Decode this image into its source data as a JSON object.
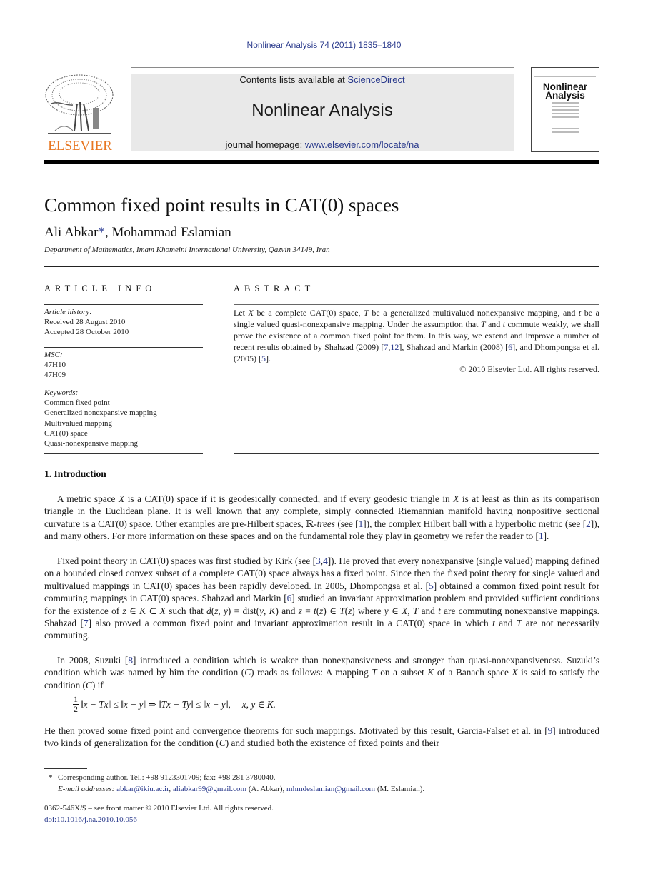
{
  "running_head": "Nonlinear Analysis 74 (2011) 1835–1840",
  "masthead": {
    "publisher_logo_text": "ELSEVIER",
    "contents_prefix": "Contents lists available at ",
    "contents_link": "ScienceDirect",
    "journal_name": "Nonlinear Analysis",
    "homepage_prefix": "journal homepage: ",
    "homepage_link": "www.elsevier.com/locate/na",
    "cover_title_line1": "Nonlinear",
    "cover_title_line2": "Analysis",
    "colors": {
      "publisher_orange": "#e87722",
      "link_blue": "#2a3a8c",
      "band_gray": "#e9e9e9"
    }
  },
  "article": {
    "title": "Common fixed point results in CAT(0) spaces",
    "authors": [
      {
        "name": "Ali Abkar",
        "mark": "*"
      },
      {
        "name": "Mohammad Eslamian",
        "mark": ""
      }
    ],
    "author_separator": ", ",
    "affiliation": "Department of Mathematics, Imam Khomeini International University, Qazvin 34149, Iran"
  },
  "article_info": {
    "heading": "ARTICLE INFO",
    "history_label": "Article history:",
    "received": "Received 28 August 2010",
    "accepted": "Accepted 28 October 2010",
    "msc_label": "MSC:",
    "msc": [
      "47H10",
      "47H09"
    ],
    "keywords_label": "Keywords:",
    "keywords": [
      "Common fixed point",
      "Generalized nonexpansive mapping",
      "Multivalued mapping",
      "CAT(0) space",
      "Quasi-nonexpansive mapping"
    ]
  },
  "abstract": {
    "heading": "ABSTRACT",
    "segments": [
      {
        "t": "Let "
      },
      {
        "t": "X",
        "i": true
      },
      {
        "t": " be a complete CAT(0) space, "
      },
      {
        "t": "T",
        "i": true
      },
      {
        "t": " be a generalized multivalued nonexpansive mapping, and "
      },
      {
        "t": "t",
        "i": true
      },
      {
        "t": " be a single valued quasi-nonexpansive mapping. Under the assumption that "
      },
      {
        "t": "T",
        "i": true
      },
      {
        "t": " and "
      },
      {
        "t": "t",
        "i": true
      },
      {
        "t": " commute weakly, we shall prove the existence of a common fixed point for them. In this way, we extend and improve a number of recent results obtained by Shahzad (2009) ["
      },
      {
        "t": "7",
        "link": true
      },
      {
        "t": ","
      },
      {
        "t": "12",
        "link": true
      },
      {
        "t": "], Shahzad and Markin (2008) ["
      },
      {
        "t": "6",
        "link": true
      },
      {
        "t": "], and Dhompongsa et al. (2005) ["
      },
      {
        "t": "5",
        "link": true
      },
      {
        "t": "]."
      }
    ],
    "copyright": "© 2010 Elsevier Ltd. All rights reserved."
  },
  "section": {
    "heading": "1. Introduction",
    "paragraphs": [
      [
        {
          "t": "A metric space "
        },
        {
          "t": "X",
          "i": true
        },
        {
          "t": " is a CAT(0) space if it is geodesically connected, and if every geodesic triangle in "
        },
        {
          "t": "X",
          "i": true
        },
        {
          "t": " is at least as thin as its comparison triangle in the Euclidean plane. It is well known that any complete, simply connected Riemannian manifold having nonpositive sectional curvature is a CAT(0) space. Other examples are pre-Hilbert spaces, ℝ-"
        },
        {
          "t": "trees",
          "i": true
        },
        {
          "t": " (see ["
        },
        {
          "t": "1",
          "link": true
        },
        {
          "t": "]), the complex Hilbert ball with a hyperbolic metric (see ["
        },
        {
          "t": "2",
          "link": true
        },
        {
          "t": "]), and many others. For more information on these spaces and on the fundamental role they play in geometry we refer the reader to ["
        },
        {
          "t": "1",
          "link": true
        },
        {
          "t": "]."
        }
      ],
      [
        {
          "t": "Fixed point theory in CAT(0) spaces was first studied by Kirk (see ["
        },
        {
          "t": "3",
          "link": true
        },
        {
          "t": ","
        },
        {
          "t": "4",
          "link": true
        },
        {
          "t": "]). He proved that every nonexpansive (single valued) mapping defined on a bounded closed convex subset of a complete CAT(0) space always has a fixed point. Since then the fixed point theory for single valued and multivalued mappings in CAT(0) spaces has been rapidly developed. In 2005, Dhompongsa et al. ["
        },
        {
          "t": "5",
          "link": true
        },
        {
          "t": "] obtained a common fixed point result for commuting mappings in CAT(0) spaces. Shahzad and Markin ["
        },
        {
          "t": "6",
          "link": true
        },
        {
          "t": "] studied an invariant approximation problem and provided sufficient conditions for the existence of "
        },
        {
          "t": "z",
          "i": true
        },
        {
          "t": " ∈ "
        },
        {
          "t": "K",
          "i": true
        },
        {
          "t": " ⊂ "
        },
        {
          "t": "X",
          "i": true
        },
        {
          "t": " such that "
        },
        {
          "t": "d",
          "i": true
        },
        {
          "t": "("
        },
        {
          "t": "z",
          "i": true
        },
        {
          "t": ", "
        },
        {
          "t": "y",
          "i": true
        },
        {
          "t": ") = dist("
        },
        {
          "t": "y",
          "i": true
        },
        {
          "t": ", "
        },
        {
          "t": "K",
          "i": true
        },
        {
          "t": ") and "
        },
        {
          "t": "z",
          "i": true
        },
        {
          "t": " = "
        },
        {
          "t": "t",
          "i": true
        },
        {
          "t": "("
        },
        {
          "t": "z",
          "i": true
        },
        {
          "t": ") ∈ "
        },
        {
          "t": "T",
          "i": true
        },
        {
          "t": "("
        },
        {
          "t": "z",
          "i": true
        },
        {
          "t": ") where "
        },
        {
          "t": "y",
          "i": true
        },
        {
          "t": " ∈ "
        },
        {
          "t": "X",
          "i": true
        },
        {
          "t": ", "
        },
        {
          "t": "T",
          "i": true
        },
        {
          "t": " and "
        },
        {
          "t": "t",
          "i": true
        },
        {
          "t": " are commuting nonexpansive mappings. Shahzad ["
        },
        {
          "t": "7",
          "link": true
        },
        {
          "t": "] also proved a common fixed point and invariant approximation result in a CAT(0) space in which "
        },
        {
          "t": "t",
          "i": true
        },
        {
          "t": " and "
        },
        {
          "t": "T",
          "i": true
        },
        {
          "t": " are not necessarily commuting."
        }
      ],
      [
        {
          "t": "In 2008, Suzuki ["
        },
        {
          "t": "8",
          "link": true
        },
        {
          "t": "] introduced a condition which is weaker than nonexpansiveness and stronger than quasi-nonexpansiveness. Suzuki’s condition which was named by him the condition ("
        },
        {
          "t": "C",
          "i": true
        },
        {
          "t": ") reads as follows: A mapping "
        },
        {
          "t": "T",
          "i": true
        },
        {
          "t": " on a subset "
        },
        {
          "t": "K",
          "i": true
        },
        {
          "t": " of a Banach space "
        },
        {
          "t": "X",
          "i": true
        },
        {
          "t": " is said to satisfy the condition ("
        },
        {
          "t": "C",
          "i": true
        },
        {
          "t": ") if"
        }
      ]
    ],
    "equation": {
      "frac_num": "1",
      "frac_den": "2",
      "body": "‖x − Tx‖ ≤ ‖x − y‖ ⇒ ‖Tx − Ty‖ ≤ ‖x − y‖,",
      "tail": "x, y ∈ K."
    },
    "paragraph_after": [
      {
        "t": "He then proved some fixed point and convergence theorems for such mappings. Motivated by this result, Garcia-Falset et al. in ["
      },
      {
        "t": "9",
        "link": true
      },
      {
        "t": "] introduced two kinds of generalization for the condition ("
      },
      {
        "t": "C",
        "i": true
      },
      {
        "t": ") and studied both the existence of fixed points and their"
      }
    ]
  },
  "footnote": {
    "star": "*",
    "corresponding": "Corresponding author. Tel.: +98 9123301709; fax: +98 281 3780040.",
    "email_label": "E-mail addresses:",
    "emails": [
      {
        "addr": "abkar@ikiu.ac.ir",
        "sep": ", "
      },
      {
        "addr": "aliabkar99@gmail.com",
        "sep": " (A. Abkar), "
      },
      {
        "addr": "mhmdeslamian@gmail.com",
        "sep": " (M. Eslamian)."
      }
    ]
  },
  "front_matter": {
    "issn_line": "0362-546X/$ – see front matter © 2010 Elsevier Ltd. All rights reserved.",
    "doi": "doi:10.1016/j.na.2010.10.056"
  }
}
